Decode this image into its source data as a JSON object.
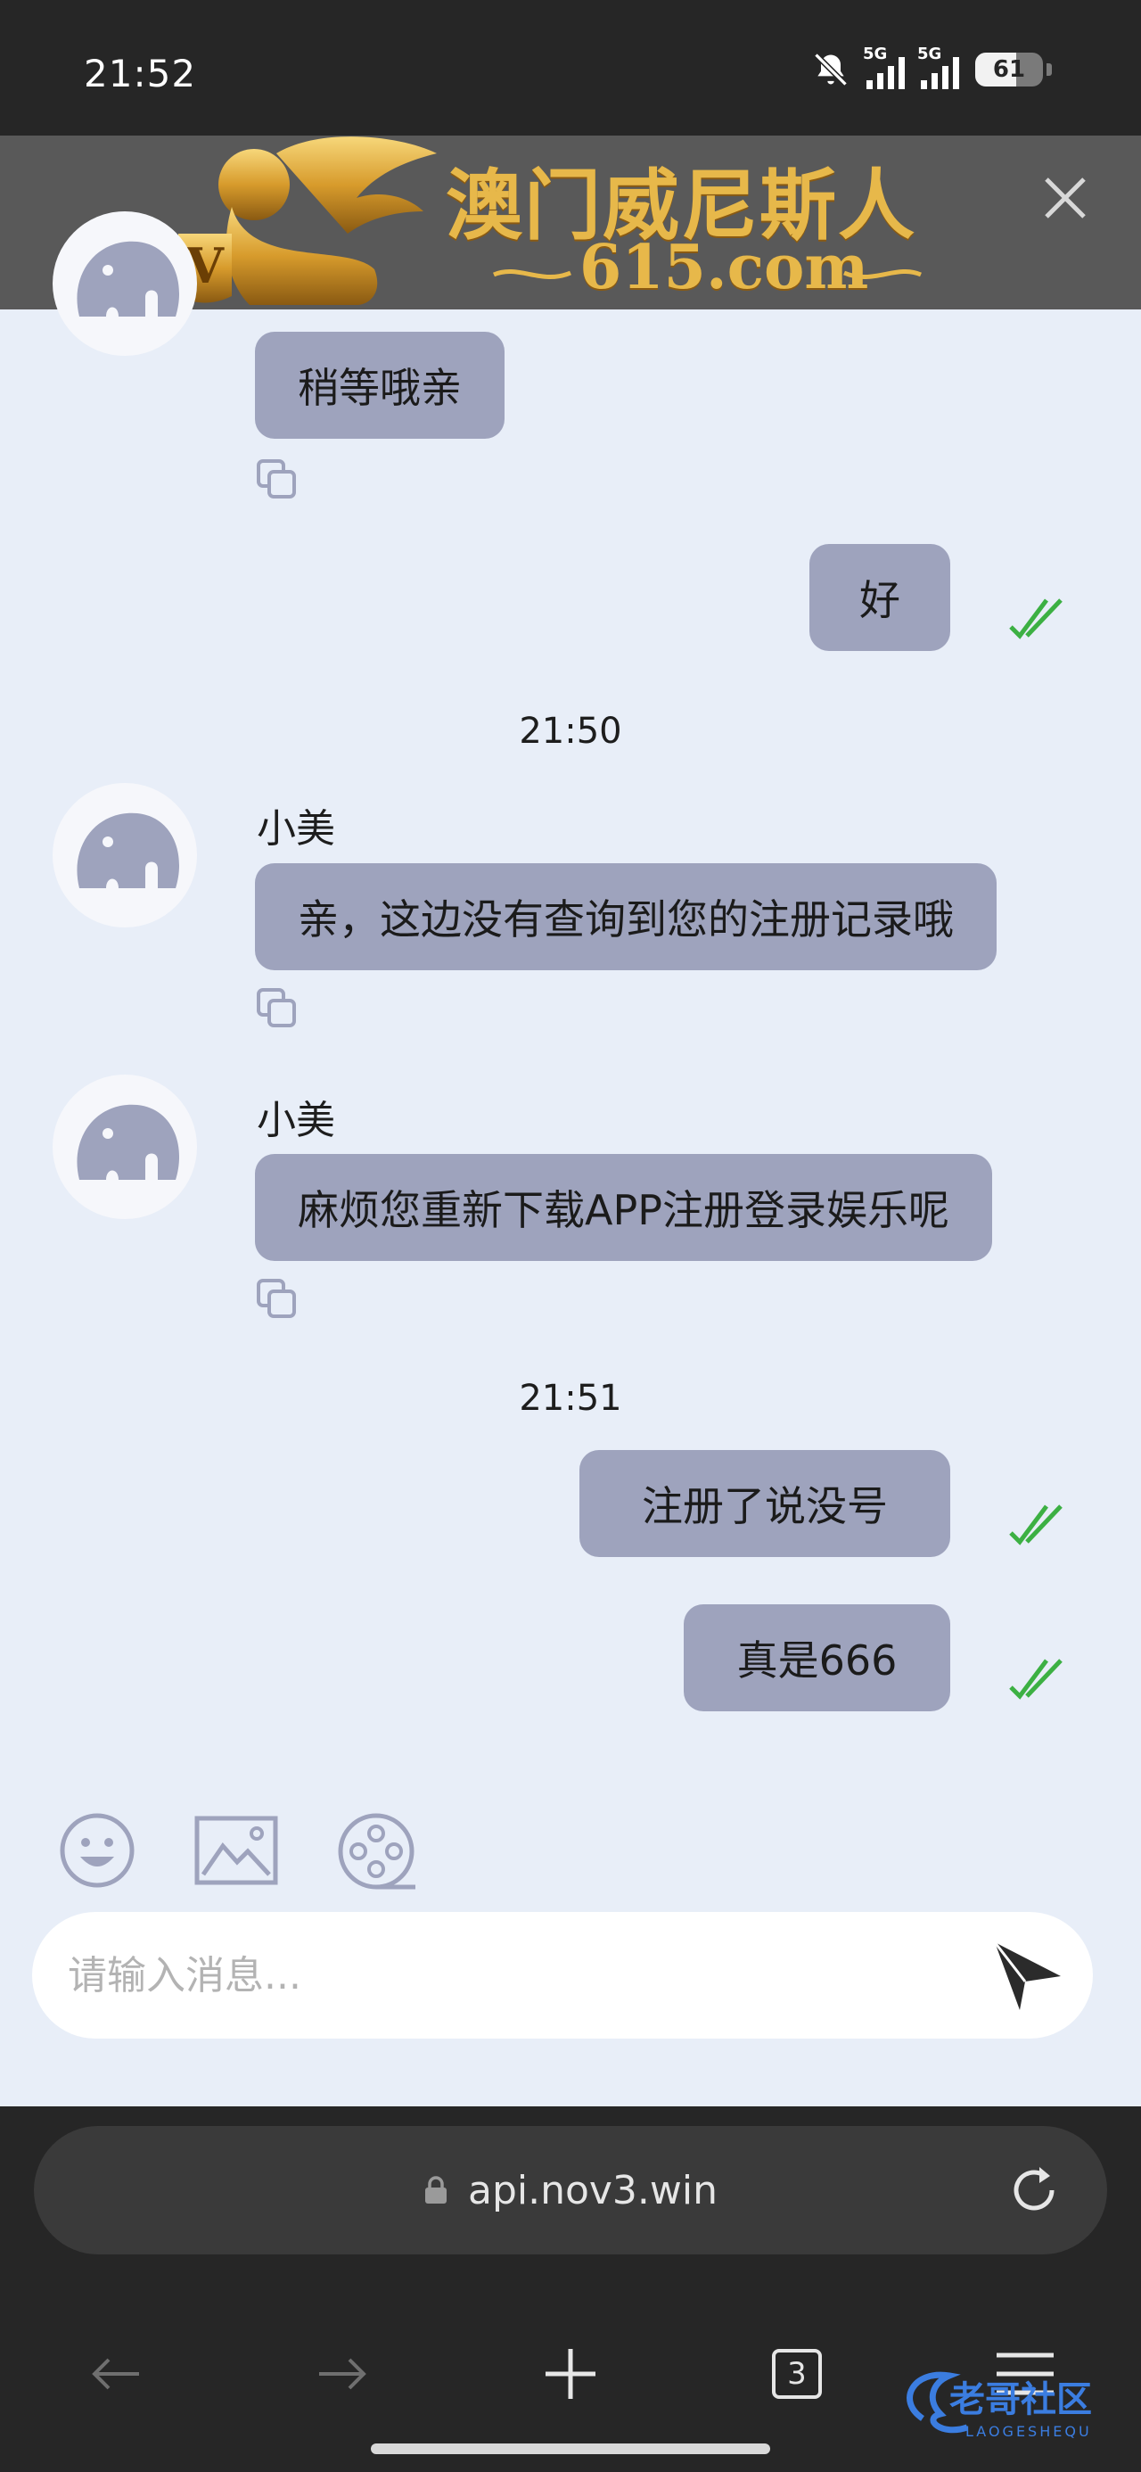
{
  "status_bar": {
    "time": "21:52",
    "network_1": "5G",
    "network_2": "5G",
    "battery_level": "61",
    "battery_fraction": 0.61,
    "icons": [
      "bell-off-icon",
      "signal-icon",
      "signal-icon",
      "battery-icon"
    ]
  },
  "banner": {
    "brand": "澳门威尼斯人",
    "domain": "615.com",
    "close_icon": "close-icon",
    "gold": "#e7b84a"
  },
  "chat": {
    "messages": [
      {
        "side": "left",
        "text": "稍等哦亲"
      },
      {
        "side": "right",
        "text": "好"
      },
      {
        "timestamp": "21:50"
      },
      {
        "side": "left",
        "sender": "小美",
        "text": "亲，这边没有查询到您的注册记录哦"
      },
      {
        "side": "left",
        "sender": "小美",
        "text": "麻烦您重新下载APP注册登录娱乐呢"
      },
      {
        "timestamp": "21:51"
      },
      {
        "side": "right",
        "text": "注册了说没号"
      },
      {
        "side": "right",
        "text": "真是666"
      }
    ],
    "bubble_color": "#9ea3bd",
    "read_check_color": "#3cb043"
  },
  "composer": {
    "placeholder": "请输入消息...",
    "tools": [
      "emoji-icon",
      "image-icon",
      "video-icon"
    ],
    "send_icon": "send-icon"
  },
  "browser": {
    "url": "api.nov3.win",
    "tab_count": "3"
  },
  "watermark": {
    "title": "老哥社区",
    "subtitle": "LAOGESHEQU"
  }
}
